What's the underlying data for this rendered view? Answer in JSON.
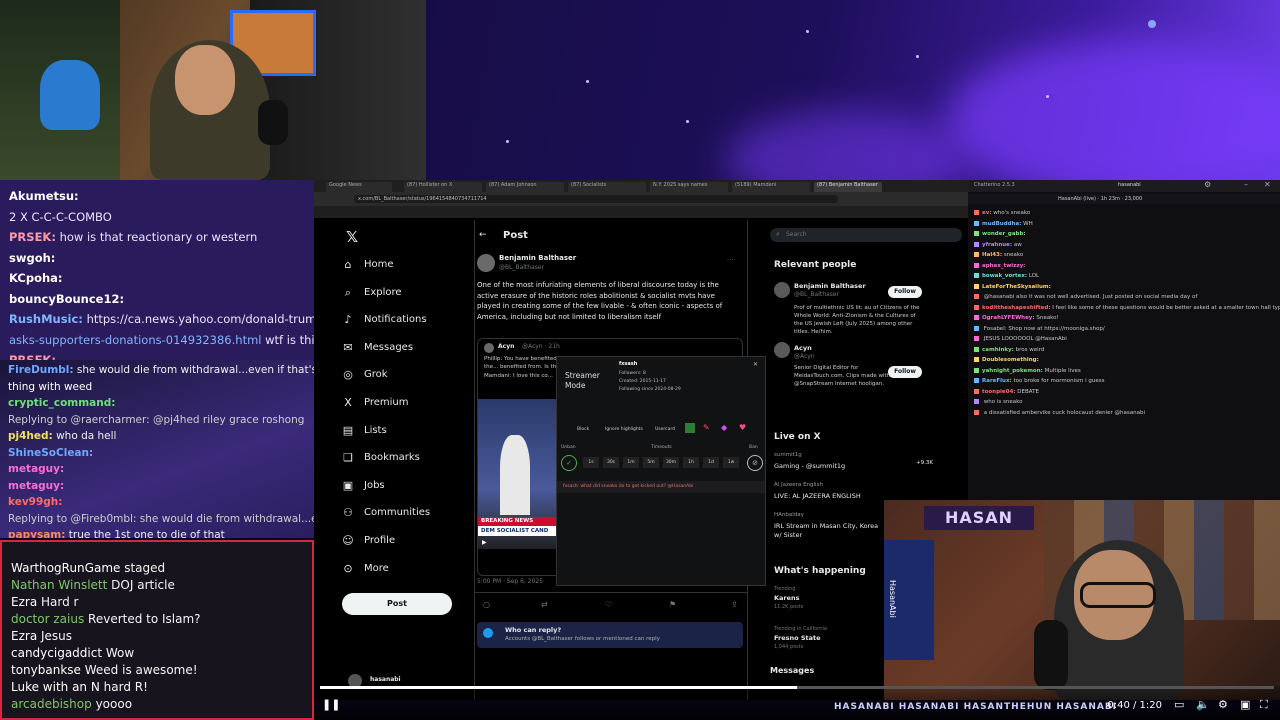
{
  "chat_top": [
    {
      "user": "Akumetsu:",
      "text": "",
      "color": "#ffffff"
    },
    {
      "user": "",
      "text": "2 X C-C-C-COMBO",
      "color": "#ffffff"
    },
    {
      "user": "PRSEK:",
      "text": "how is that reactionary or western",
      "color": "#ff9aa8"
    },
    {
      "user": "swgoh:",
      "text": "",
      "color": "#ffffff"
    },
    {
      "user": "KCpoha:",
      "text": "",
      "color": "#ffffff"
    },
    {
      "user": "bouncyBounce12:",
      "text": "",
      "color": "#ffffff"
    },
    {
      "user": "RushMusic:",
      "text": "https://ca.news.yahoo.com/donald-trump-",
      "color": "#7fb6ff"
    },
    {
      "user": "",
      "text": "asks-supporters-donations-014932386.html",
      "suffix": "wtf is this",
      "color": "#7fb6ff"
    },
    {
      "user": "PRSEK:",
      "text": "",
      "color": "#ff9aa8"
    }
  ],
  "chat_mid": [
    {
      "user": "FireDumbl:",
      "text": "she would die from withdrawal...even if that's not a",
      "color": "#6fa8ff"
    },
    {
      "user": "",
      "text": "thing with weed",
      "color": "#ffffff"
    },
    {
      "user": "cryptic_command:",
      "text": "",
      "color": "#6fe07a"
    },
    {
      "user": "",
      "text": "Replying to @raercharmer: @pj4hed riley grace roshong",
      "color": "#cfcfcf"
    },
    {
      "user": "pj4hed:",
      "text": "who da hell",
      "color": "#f4e15a"
    },
    {
      "user": "ShineSoClean:",
      "text": "",
      "color": "#6fa8ff"
    },
    {
      "user": "metaguy:",
      "text": "",
      "color": "#ff6bd5"
    },
    {
      "user": "metaguy:",
      "text": "",
      "color": "#ff6bd5"
    },
    {
      "user": "kev99gh:",
      "text": "",
      "color": "#ff6b6b"
    },
    {
      "user": "",
      "text": "Replying to @Fireb0mbl: she would die from withdrawal...even if that's not c...",
      "color": "#cfcfcf"
    },
    {
      "user": "papysam:",
      "text": "true",
      "suffix": "the 1st one to die of that",
      "color": "#ff8a5c"
    }
  ],
  "chat_bottom": [
    {
      "user": "WarthogRunGame",
      "text": "staged",
      "color": "#ffffff"
    },
    {
      "user": "Nathan Winslett",
      "text": "DOJ article",
      "color": "#7ec96a"
    },
    {
      "user": "Ezra",
      "text": "Hard r",
      "color": "#ffffff"
    },
    {
      "user": "doctor zaius",
      "text": "Reverted to Islam?",
      "color": "#7ec96a"
    },
    {
      "user": "Ezra",
      "text": "Jesus",
      "color": "#ffffff"
    },
    {
      "user": "candycigaddict",
      "text": "Wow",
      "color": "#ffffff"
    },
    {
      "user": "tonybankse",
      "text": "Weed is awesome!",
      "color": "#ffffff"
    },
    {
      "user": "Luke with an N",
      "text": "hard R!",
      "color": "#ffffff"
    },
    {
      "user": "arcadebishop",
      "text": "yoooo",
      "color": "#7ec96a"
    }
  ],
  "x": {
    "nav": [
      {
        "label": "Home",
        "icon": "⌂"
      },
      {
        "label": "Explore",
        "icon": "⌕"
      },
      {
        "label": "Notifications",
        "icon": "♪"
      },
      {
        "label": "Messages",
        "icon": "✉"
      },
      {
        "label": "Grok",
        "icon": "◎"
      },
      {
        "label": "Premium",
        "icon": "X"
      },
      {
        "label": "Lists",
        "icon": "▤"
      },
      {
        "label": "Bookmarks",
        "icon": "❏"
      },
      {
        "label": "Jobs",
        "icon": "▣"
      },
      {
        "label": "Communities",
        "icon": "⚇"
      },
      {
        "label": "Profile",
        "icon": "☺"
      },
      {
        "label": "More",
        "icon": "⊙"
      }
    ],
    "post_button": "Post",
    "post_header": "Post",
    "author": "Benjamin Balthaser",
    "handle": "@BL_Balthaser",
    "post_text": "One of the most infuriating elements of liberal discourse today is the active erasure of the historic roles abolitionist & socialist mvts have played in creating some of the few livable - & often iconic - aspects of America, including but not limited to liberalism itself",
    "quoted_author": "Acyn",
    "quoted_handle": "@Acyn · 21h",
    "quoted_text": "Phillip: You have benefited from this country... this is what you... But you don't support the... benefited from. Is that",
    "quoted_sub": "Mamdani: I love this co...",
    "news_banner": "BREAKING NEWS",
    "news_caption": "DEM SOCIALIST CAND",
    "post_meta": "5:00 PM · Sep 6, 2025",
    "who_can_reply": "Who can reply?",
    "reply_note": "Accounts @BL_Balthaser follows or mentioned can reply",
    "account_name": "hasanabi",
    "search_placeholder": "Search",
    "relevant_people": "Relevant people",
    "rp1_name": "Benjamin Balthaser",
    "rp1_handle": "@BL_Balthaser",
    "rp1_bio": "Prof of multiethnic US lit; au of Citizens of the Whole World: Anti-Zionism & the Cultures of the US Jewish Left (July 2025) among other titles. He/him.",
    "rp2_name": "Acyn",
    "rp2_handle": "@Acyn",
    "rp2_bio": "Senior Digital Editor for MeidasTouch.com. Clips made with @SnapStream Internet hooligan.",
    "follow": "Follow",
    "live_on_x": "Live on X",
    "live1_user": "summit1g",
    "live1_title": "Gaming - @summit1g",
    "live1_count": "+9.3K",
    "live2_user": "Al Jazeera English",
    "live2_title": "LIVE: AL JAZEERA ENGLISH",
    "live3_user": "HAnbalday",
    "live3_title": "IRL Stream in Masan City, Korea w/ Sister",
    "whats_happening": "What's happening",
    "trend1_meta": "Trending",
    "trend1": "Karens",
    "trend1_posts": "11.2K posts",
    "trend2_meta": "Trending in California",
    "trend2": "Fresno State",
    "trend2_posts": "1,044 posts",
    "messages_drawer": "Messages"
  },
  "streamer_mode": {
    "title": "Streamer Mode",
    "user": "fxsash",
    "followers": "Followers: 8",
    "created": "Created: 2015-11-17",
    "following": "Following since 2024-08-29",
    "block": "Block",
    "ignore": "Ignore highlights",
    "usercard": "Usercard",
    "unban": "Unban",
    "timeouts": "Timeouts",
    "ban": "Ban",
    "timeout_options": [
      "1s",
      "30s",
      "1m",
      "5m",
      "30m",
      "1h",
      "1d",
      "1w"
    ],
    "log_line": "fxsash: what did sneako do to get kicked out? @HasanAbi"
  },
  "chatterino": {
    "title": "Chatterino 2.5.3",
    "channel": "hasanabi",
    "header": "HasanAbi (live) · 1h 23m · 23,000",
    "lines": [
      {
        "user": "ev:",
        "text": "who's sneako",
        "color": "#ff6a6a"
      },
      {
        "user": "mudBuddha:",
        "text": "WH",
        "color": "#6ab7ff"
      },
      {
        "user": "wonder_gabb:",
        "text": "",
        "color": "#7ee07e"
      },
      {
        "user": "yfrahnue:",
        "text": "aw",
        "color": "#b48aff"
      },
      {
        "user": "Hal43:",
        "text": "sneako",
        "color": "#ffb86a"
      },
      {
        "user": "aphex_twizzy:",
        "text": "",
        "color": "#ff6ad5"
      },
      {
        "user": "bowak_vortex:",
        "text": "LOL",
        "color": "#6ae0d5"
      },
      {
        "user": "LateForTheSkysailum:",
        "text": "",
        "color": "#ffd36a"
      },
      {
        "user": "",
        "text": "@hasanabi also it was not well advertised. Just posted on social media day of",
        "color": "#ff6a6a"
      },
      {
        "user": "kodittheshapeshifted:",
        "text": "I feel like some of these questions would be better asked at a smaller town hall type gathering, with less pressure, and more time. can't fault people for asking about the things they care about, and ending up in a meandering mess. i wish someone grilled bernie over israel @HasanAbi",
        "color": "#ff6a6a"
      },
      {
        "user": "OgrahLYFEWhey:",
        "text": "Sneako!",
        "color": "#ff6ad5"
      },
      {
        "user": "",
        "text": "Fosabel: Shop now at https://mooniga.shop/",
        "color": "#6ab7ff"
      },
      {
        "user": "",
        "text": "JESUS LOOOOOOL @HasanAbi",
        "color": "#ff6ad5"
      },
      {
        "user": "camhinky:",
        "text": "bros weird",
        "color": "#7ee07e"
      },
      {
        "user": "Doublesomething:",
        "text": "",
        "color": "#ffd36a"
      },
      {
        "user": "yahnight_pokemon:",
        "text": "Multiple lives",
        "color": "#7ee07e"
      },
      {
        "user": "RareFlux:",
        "text": "too broke for mormonism i guess",
        "color": "#6ab7ff"
      },
      {
        "user": "toonpie04:",
        "text": "DEBATE",
        "color": "#ff6a6a"
      },
      {
        "user": "",
        "text": "who is sneako",
        "color": "#b48aff"
      },
      {
        "user": "",
        "text": "a dissatisfied ambervike cuck holocaust denier @hasanabi",
        "color": "#ff6a6a"
      }
    ]
  },
  "player": {
    "time": "0:40 / 1:20",
    "progress": 0.5,
    "overlay_banner": "HASANABI  HASANABI  HASANTHEHUN  HASANABI"
  },
  "cam2_sign": "HASAN",
  "cam2_flag": "HasanAbi",
  "colors": {
    "x_bg": "#000000",
    "follow": "#eff3f4",
    "chat_border": "#d7263d",
    "accent": "#1d9bf0"
  }
}
